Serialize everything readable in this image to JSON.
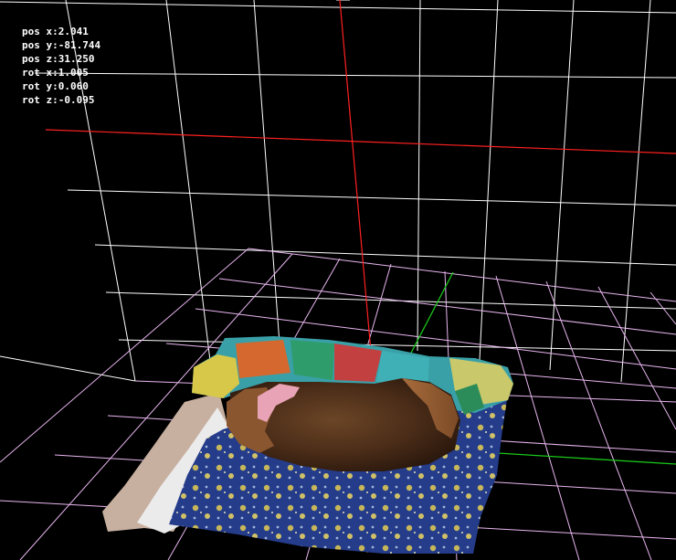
{
  "viewer": {
    "background_color": "#000000",
    "grid_wall_color": "#ffffff",
    "grid_floor_color": "#e9b6f0",
    "axis_x_color": "#ff2020",
    "axis_y_color": "#19c819",
    "axis_z_color": "#ff2020",
    "object": "3d-scan-dog-sleeping-on-blanket"
  },
  "hud": {
    "pos_x": "pos x:2.041",
    "pos_y": "pos y:-81.744",
    "pos_z": "pos z:31.250",
    "rot_x": "rot x:1.005",
    "rot_y": "rot y:0.060",
    "rot_z": "rot z:-0.095"
  }
}
